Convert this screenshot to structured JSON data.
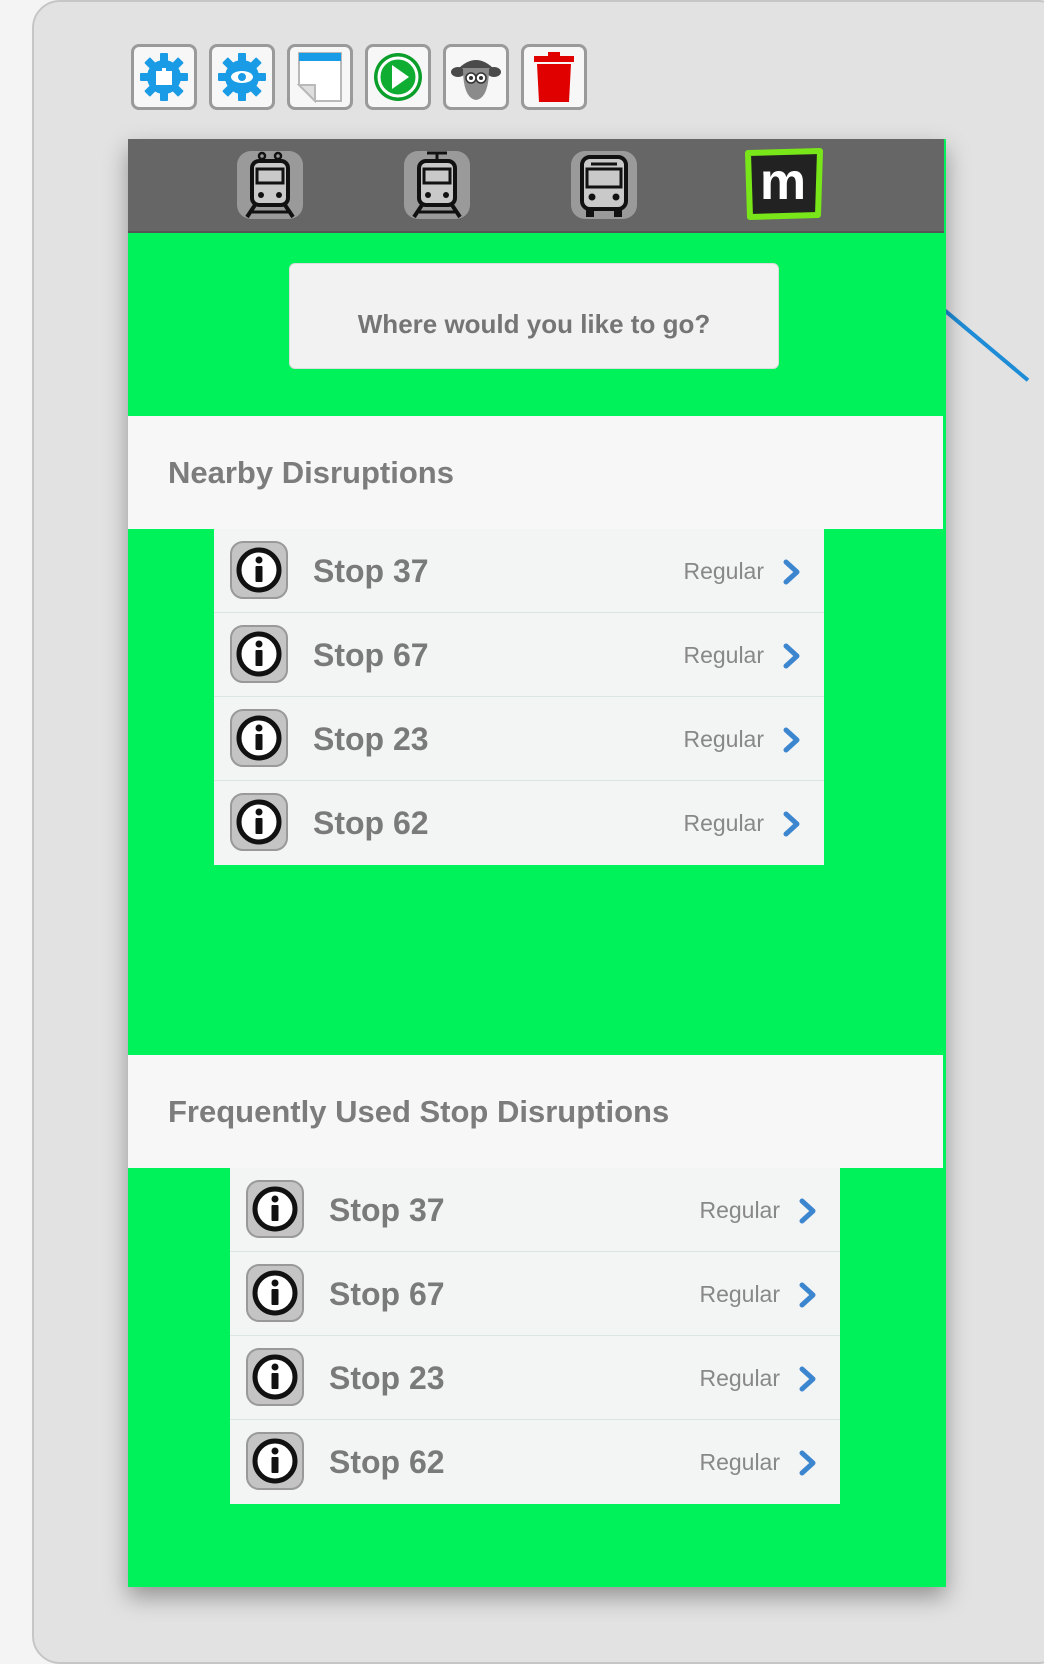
{
  "toolbar": {
    "buttons": [
      {
        "name": "gear-puzzle-icon",
        "color": "#1a9be6"
      },
      {
        "name": "gear-eye-icon",
        "color": "#1a9be6"
      },
      {
        "name": "page-icon",
        "color": "#1a9be6"
      },
      {
        "name": "play-icon",
        "color": "#0a9e2a"
      },
      {
        "name": "sheep-icon",
        "color": "#555555"
      },
      {
        "name": "trash-icon",
        "color": "#e00000"
      }
    ]
  },
  "app": {
    "accent_color": "#00f25a",
    "topbar_color": "#666666",
    "modes": [
      {
        "name": "train-icon"
      },
      {
        "name": "tram-icon"
      },
      {
        "name": "bus-icon"
      },
      {
        "name": "m-logo-icon",
        "text": "m"
      }
    ],
    "search": {
      "placeholder": "Where would you like to go?"
    }
  },
  "nearby": {
    "title": "Nearby Disruptions",
    "items": [
      {
        "stop": "Stop 37",
        "status": "Regular"
      },
      {
        "stop": "Stop 67",
        "status": "Regular"
      },
      {
        "stop": "Stop 23",
        "status": "Regular"
      },
      {
        "stop": "Stop 62",
        "status": "Regular"
      }
    ]
  },
  "frequent": {
    "title": "Frequently Used Stop Disruptions",
    "items": [
      {
        "stop": "Stop 37",
        "status": "Regular"
      },
      {
        "stop": "Stop 67",
        "status": "Regular"
      },
      {
        "stop": "Stop 23",
        "status": "Regular"
      },
      {
        "stop": "Stop 62",
        "status": "Regular"
      }
    ]
  }
}
